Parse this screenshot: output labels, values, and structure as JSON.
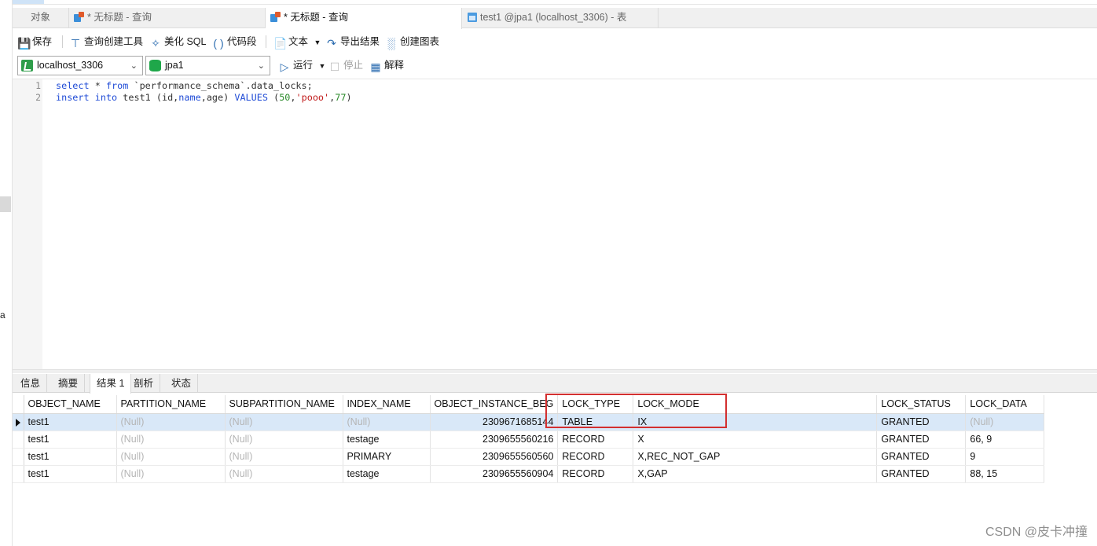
{
  "tabs": [
    {
      "label": "对象"
    },
    {
      "label": "* 无标题 - 查询"
    },
    {
      "label": "* 无标题 - 查询"
    },
    {
      "label": "test1 @jpa1 (localhost_3306) - 表"
    }
  ],
  "toolbar": {
    "save": "保存",
    "query_builder": "查询创建工具",
    "beautify": "美化 SQL",
    "snippet": "代码段",
    "text": "文本",
    "export": "导出结果",
    "create_chart": "创建图表"
  },
  "connection": {
    "value": "localhost_3306"
  },
  "database": {
    "value": "jpa1"
  },
  "run": {
    "run": "运行",
    "stop": "停止",
    "explain": "解释"
  },
  "editor": {
    "line_numbers": [
      "1",
      "2"
    ],
    "line1": {
      "kw1": "select",
      "mid1": " * ",
      "kw2": "from",
      "rest": " `performance_schema`.data_locks;"
    },
    "line2": {
      "kw1": "insert",
      "kw2": "into",
      "mid": " test1 (id,",
      "kw3": "name",
      "mid2": ",age) ",
      "kw4": "VALUES",
      "open": " (",
      "n1": "50",
      "comma1": ",",
      "s1": "'pooo'",
      "comma2": ",",
      "n2": "77",
      "close": ")"
    }
  },
  "left_strip": {
    "letter": "a"
  },
  "result_tabs": [
    {
      "label": "信息"
    },
    {
      "label": "摘要"
    },
    {
      "label": "结果 1"
    },
    {
      "label": "剖析"
    },
    {
      "label": "状态"
    }
  ],
  "grid": {
    "columns": [
      "OBJECT_NAME",
      "PARTITION_NAME",
      "SUBPARTITION_NAME",
      "INDEX_NAME",
      "OBJECT_INSTANCE_BEG",
      "LOCK_TYPE",
      "LOCK_MODE",
      "LOCK_STATUS",
      "LOCK_DATA"
    ],
    "rows": [
      [
        "test1",
        "(Null)",
        "(Null)",
        "(Null)",
        "2309671685144",
        "TABLE",
        "IX",
        "GRANTED",
        "(Null)"
      ],
      [
        "test1",
        "(Null)",
        "(Null)",
        "testage",
        "2309655560216",
        "RECORD",
        "X",
        "GRANTED",
        "66, 9"
      ],
      [
        "test1",
        "(Null)",
        "(Null)",
        "PRIMARY",
        "2309655560560",
        "RECORD",
        "X,REC_NOT_GAP",
        "GRANTED",
        "9"
      ],
      [
        "test1",
        "(Null)",
        "(Null)",
        "testage",
        "2309655560904",
        "RECORD",
        "X,GAP",
        "GRANTED",
        "88, 15"
      ]
    ]
  },
  "watermark": "CSDN @皮卡冲撞",
  "colors": {
    "highlight": "#d32f2f",
    "selected_row": "#d9e8f8",
    "keyword": "#1f4bd6",
    "string": "#c01919",
    "number": "#2a8a2a"
  }
}
